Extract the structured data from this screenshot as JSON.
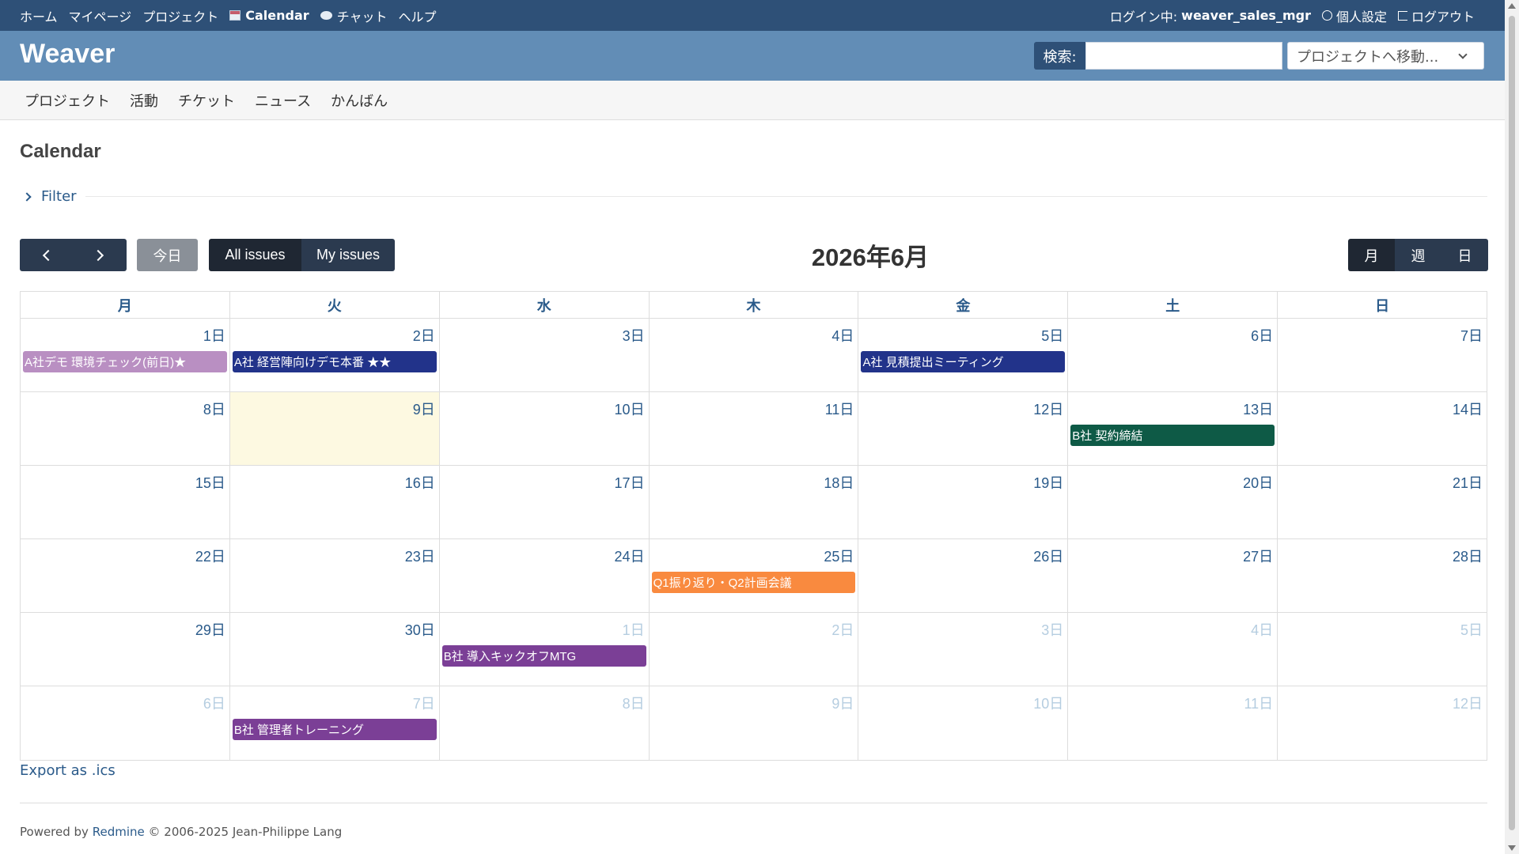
{
  "top_menu": {
    "home": "ホーム",
    "mypage": "マイページ",
    "projects": "プロジェクト",
    "calendar": "Calendar",
    "chat": "チャット",
    "help": "ヘルプ"
  },
  "account": {
    "logged_in_label": "ログイン中:",
    "username": "weaver_sales_mgr",
    "my_account": "個人設定",
    "logout": "ログアウト"
  },
  "header": {
    "site_title": "Weaver",
    "search_label": "検索:",
    "search_value": "",
    "jump_placeholder": "プロジェクトへ移動..."
  },
  "main_menu": [
    "プロジェクト",
    "活動",
    "チケット",
    "ニュース",
    "かんばん"
  ],
  "page_title": "Calendar",
  "filter_label": "Filter",
  "toolbar": {
    "today": "今日",
    "all_issues": "All issues",
    "my_issues": "My issues",
    "month_title": "2026年6月",
    "view_month": "月",
    "view_week": "週",
    "view_day": "日"
  },
  "weekdays": [
    "月",
    "火",
    "水",
    "木",
    "金",
    "土",
    "日"
  ],
  "weeks": [
    [
      {
        "label": "1日"
      },
      {
        "label": "2日"
      },
      {
        "label": "3日"
      },
      {
        "label": "4日"
      },
      {
        "label": "5日"
      },
      {
        "label": "6日"
      },
      {
        "label": "7日"
      }
    ],
    [
      {
        "label": "8日"
      },
      {
        "label": "9日",
        "today": true
      },
      {
        "label": "10日"
      },
      {
        "label": "11日"
      },
      {
        "label": "12日"
      },
      {
        "label": "13日"
      },
      {
        "label": "14日"
      }
    ],
    [
      {
        "label": "15日"
      },
      {
        "label": "16日"
      },
      {
        "label": "17日"
      },
      {
        "label": "18日"
      },
      {
        "label": "19日"
      },
      {
        "label": "20日"
      },
      {
        "label": "21日"
      }
    ],
    [
      {
        "label": "22日"
      },
      {
        "label": "23日"
      },
      {
        "label": "24日"
      },
      {
        "label": "25日"
      },
      {
        "label": "26日"
      },
      {
        "label": "27日"
      },
      {
        "label": "28日"
      }
    ],
    [
      {
        "label": "29日"
      },
      {
        "label": "30日"
      },
      {
        "label": "1日",
        "other": true
      },
      {
        "label": "2日",
        "other": true
      },
      {
        "label": "3日",
        "other": true
      },
      {
        "label": "4日",
        "other": true
      },
      {
        "label": "5日",
        "other": true
      }
    ],
    [
      {
        "label": "6日",
        "other": true
      },
      {
        "label": "7日",
        "other": true
      },
      {
        "label": "8日",
        "other": true
      },
      {
        "label": "9日",
        "other": true
      },
      {
        "label": "10日",
        "other": true
      },
      {
        "label": "11日",
        "other": true
      },
      {
        "label": "12日",
        "other": true
      }
    ]
  ],
  "events": [
    {
      "week": 0,
      "day": 0,
      "title": "A社デモ 環境チェック(前日)★",
      "color": "#b98fc2"
    },
    {
      "week": 0,
      "day": 1,
      "title": "A社 経営陣向けデモ本番 ★★",
      "color": "#22338a"
    },
    {
      "week": 0,
      "day": 4,
      "title": "A社 見積提出ミーティング",
      "color": "#22338a"
    },
    {
      "week": 1,
      "day": 5,
      "title": "B社 契約締結",
      "color": "#0e5a46"
    },
    {
      "week": 3,
      "day": 3,
      "title": "Q1振り返り・Q2計画会議",
      "color": "#f98a3f"
    },
    {
      "week": 4,
      "day": 2,
      "title": "B社 導入キックオフMTG",
      "color": "#7b3f96"
    },
    {
      "week": 5,
      "day": 1,
      "title": "B社 管理者トレーニング",
      "color": "#7b3f96"
    }
  ],
  "export_label": "Export as .ics",
  "footer": {
    "powered_by": "Powered by",
    "redmine": "Redmine",
    "copyright": "© 2006-2025 Jean-Philippe Lang"
  },
  "colors": {
    "topbar": "#2e5077",
    "header": "#628db6",
    "link": "#2a5a8a",
    "today_bg": "#fdf9e1"
  }
}
